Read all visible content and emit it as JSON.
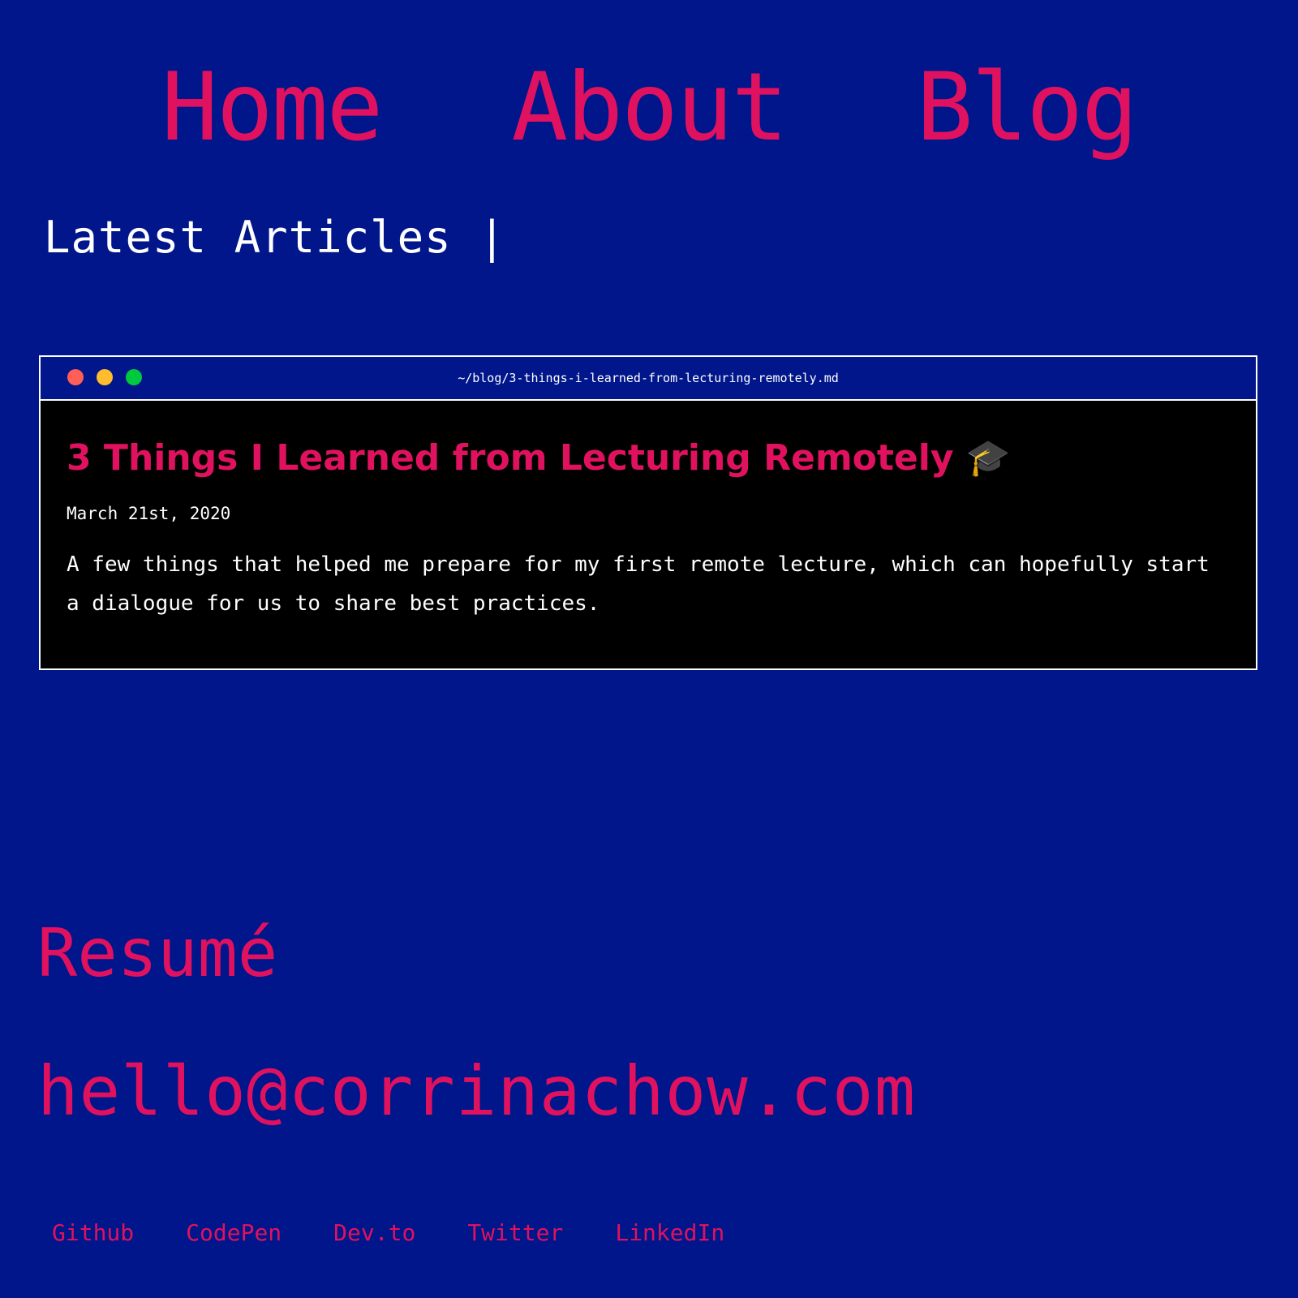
{
  "colors": {
    "background": "#00168a",
    "accent": "#e0125f",
    "text": "#ffffff",
    "card_background": "#000000",
    "window_dot_red": "#ff5f57",
    "window_dot_yellow": "#febc2e",
    "window_dot_green": "#00c940"
  },
  "nav": {
    "items": [
      {
        "label": "Home"
      },
      {
        "label": "About"
      },
      {
        "label": "Blog"
      }
    ]
  },
  "latest": {
    "heading": "Latest Articles |"
  },
  "article": {
    "path": "~/blog/3-things-i-learned-from-lecturing-remotely.md",
    "title": "3 Things I Learned from Lecturing Remotely 🎓",
    "date": "March 21st, 2020",
    "excerpt": "A few things that helped me prepare for my first remote lecture, which can hopefully start a dialogue for us to share best practices."
  },
  "footer": {
    "resume_label": "Resumé",
    "email": "hello@corrinachow.com",
    "social": [
      {
        "label": "Github"
      },
      {
        "label": "CodePen"
      },
      {
        "label": "Dev.to"
      },
      {
        "label": "Twitter"
      },
      {
        "label": "LinkedIn"
      }
    ]
  }
}
